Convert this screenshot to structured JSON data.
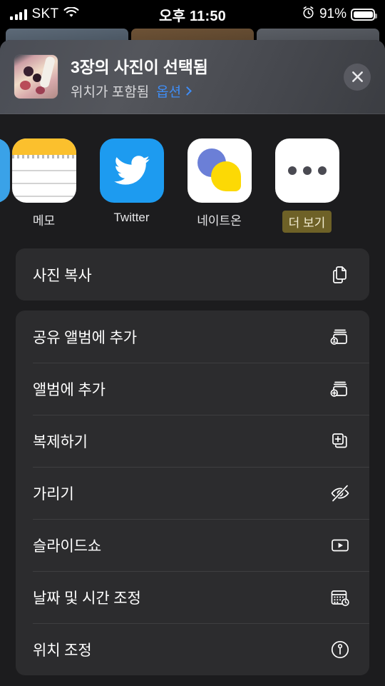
{
  "status_bar": {
    "carrier": "SKT",
    "wifi_icon": "wifi-icon",
    "signal_icon": "cellular-bars-icon",
    "time": "오후 11:50",
    "alarm_icon": "alarm-clock-icon",
    "battery_percent": "91%",
    "battery_icon": "battery-icon"
  },
  "header": {
    "thumbnail_name": "selected-photo-thumbnail",
    "title": "3장의 사진이 선택됨",
    "subtitle": "위치가 포함됨",
    "options_label": "옵션",
    "options_chevron_icon": "chevron-right-icon",
    "close_icon": "close-icon"
  },
  "apps": [
    {
      "label": "",
      "icon": "telegram-icon",
      "partial": true
    },
    {
      "label": "메모",
      "icon": "notes-icon",
      "partial": false
    },
    {
      "label": "Twitter",
      "icon": "twitter-icon",
      "partial": false
    },
    {
      "label": "네이트온",
      "icon": "nateon-icon",
      "partial": false
    },
    {
      "label": "더 보기",
      "icon": "more-ellipsis-icon",
      "partial": false,
      "highlighted": true
    }
  ],
  "action_groups": [
    {
      "rows": [
        {
          "label": "사진 복사",
          "icon": "copy-doc-on-doc-icon"
        }
      ]
    },
    {
      "rows": [
        {
          "label": "공유 앨범에 추가",
          "icon": "shared-album-person-icon"
        },
        {
          "label": "앨범에 추가",
          "icon": "album-plus-icon"
        },
        {
          "label": "복제하기",
          "icon": "duplicate-plus-square-icon"
        },
        {
          "label": "가리기",
          "icon": "eye-slash-icon"
        },
        {
          "label": "슬라이드쇼",
          "icon": "play-rectangle-icon"
        },
        {
          "label": "날짜 및 시간 조정",
          "icon": "calendar-clock-icon"
        },
        {
          "label": "위치 조정",
          "icon": "location-pin-circle-icon"
        }
      ]
    }
  ],
  "colors": {
    "sheet_background": "#1c1c1e",
    "card_background": "#2c2c2e",
    "accent_blue": "#3f8df5",
    "highlight_olive": "#6e6127",
    "text_primary": "#ffffff",
    "text_secondary": "#d8d8db"
  }
}
